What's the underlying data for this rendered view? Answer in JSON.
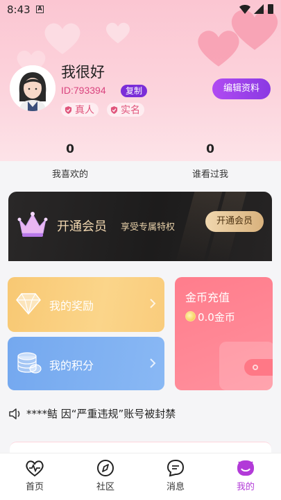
{
  "status_bar": {
    "time": "8:43",
    "notification_icon": "A"
  },
  "profile": {
    "nickname": "我很好",
    "id_text": "ID:793394",
    "copy_label": "复制",
    "tags": [
      "真人",
      "实名"
    ],
    "edit_label": "编辑资料"
  },
  "stats": [
    {
      "value": "0",
      "label": "我喜欢的"
    },
    {
      "value": "0",
      "label": "谁看过我"
    }
  ],
  "vip": {
    "title": "开通会员",
    "subtitle": "享受专属特权",
    "button": "开通会员"
  },
  "cards": {
    "reward": "我的奖励",
    "points": "我的积分",
    "coin_title": "金币充值",
    "coin_amount": "0.0金币"
  },
  "notice": "****鲒 因“严重违规”账号被封禁",
  "tabs": [
    {
      "label": "首页",
      "icon": "heart-pulse-icon",
      "active": false
    },
    {
      "label": "社区",
      "icon": "compass-icon",
      "active": false
    },
    {
      "label": "消息",
      "icon": "message-icon",
      "active": false
    },
    {
      "label": "我的",
      "icon": "profile-face-icon",
      "active": true
    }
  ],
  "colors": {
    "accent": "#b23ad8",
    "hero_pink": "#fbc6d2",
    "copy_purple": "#7b2ed8",
    "id_pink": "#d9437e"
  }
}
